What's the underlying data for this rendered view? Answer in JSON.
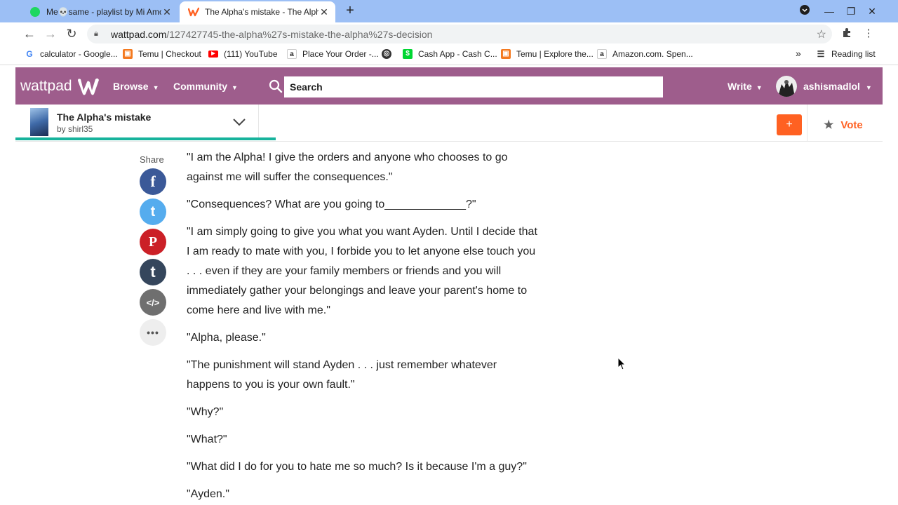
{
  "browser": {
    "tabs": [
      {
        "title": "Me💀same - playlist by Mi Amor",
        "active": false
      },
      {
        "title": "The Alpha's mistake - The Alpha",
        "active": true
      }
    ],
    "url_host": "wattpad.com",
    "url_path": "/127427745-the-alpha%27s-mistake-the-alpha%27s-decision",
    "bookmarks": [
      {
        "label": "calculator - Google...",
        "icon": "google-icon"
      },
      {
        "label": "Temu | Checkout",
        "icon": "temu-icon"
      },
      {
        "label": "(111) YouTube",
        "icon": "youtube-icon"
      },
      {
        "label": "Place Your Order -...",
        "icon": "amazon-icon"
      },
      {
        "label": "",
        "icon": "globe-icon"
      },
      {
        "label": "Cash App - Cash C...",
        "icon": "cashapp-icon"
      },
      {
        "label": "Temu | Explore the...",
        "icon": "temu-icon"
      },
      {
        "label": "Amazon.com. Spen...",
        "icon": "amazon-icon"
      }
    ],
    "reading_list": "Reading list",
    "more_bookmarks": "»"
  },
  "header": {
    "logo": "wattpad",
    "browse": "Browse",
    "community": "Community",
    "search_placeholder": "Search",
    "write": "Write",
    "username": "ashismadlol"
  },
  "story": {
    "title": "The Alpha's mistake",
    "author": "by shirl35",
    "add_label": "+",
    "vote_label": "Vote",
    "progress": 0.3
  },
  "share": {
    "label": "Share",
    "buttons": [
      {
        "name": "facebook",
        "color": "#3b5998",
        "glyph": "f"
      },
      {
        "name": "twitter",
        "color": "#55acee",
        "glyph": "t"
      },
      {
        "name": "pinterest",
        "color": "#cb2027",
        "glyph": "P"
      },
      {
        "name": "tumblr",
        "color": "#35465c",
        "glyph": "t"
      },
      {
        "name": "embed",
        "color": "#6f6f6f",
        "glyph": "</>"
      },
      {
        "name": "more",
        "color": "#eeeeee",
        "glyph": "•••"
      }
    ]
  },
  "paragraphs": [
    "\"I am the Alpha! I give the orders and anyone who chooses to go against me will suffer the consequences.\"",
    "\"Consequences? What are you going to_____________?\"",
    "\"I am simply going to give you what you want Ayden. Until I decide that I am ready to mate with you, I forbide you to let anyone else touch you . . . even if they are your family members or friends and you will immediately gather your belongings and leave your parent's home to come here and live with me.\"",
    "\"Alpha, please.\"",
    "\"The punishment will stand Ayden . . . just remember whatever happens to you is your own fault.\"",
    "\"Why?\"",
    "\"What?\"",
    "\"What did I do for you to hate me so much? Is it because I'm a guy?\"",
    "\"Ayden.\""
  ],
  "colors": {
    "wattpad_header": "#9e5d8c",
    "accent_orange": "#ff6122",
    "progress_teal": "#17b39c",
    "tab_strip": "#9cbff5"
  }
}
